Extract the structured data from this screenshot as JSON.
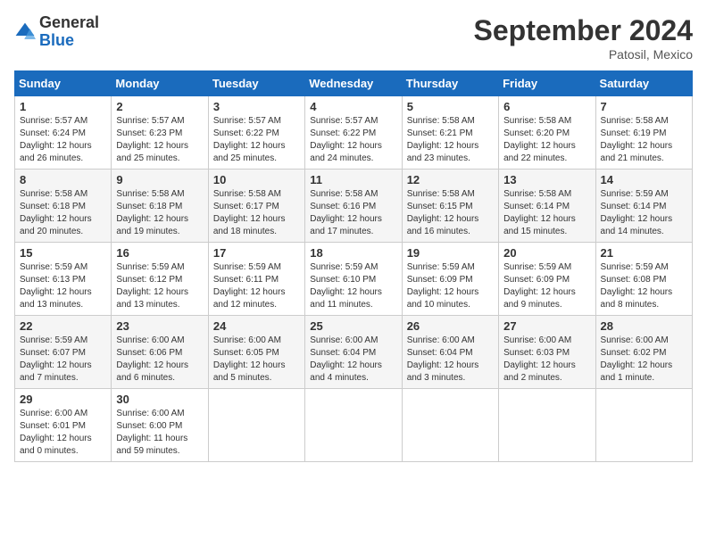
{
  "header": {
    "logo_general": "General",
    "logo_blue": "Blue",
    "title": "September 2024",
    "location": "Patosil, Mexico"
  },
  "columns": [
    "Sunday",
    "Monday",
    "Tuesday",
    "Wednesday",
    "Thursday",
    "Friday",
    "Saturday"
  ],
  "weeks": [
    [
      {
        "day": "1",
        "sunrise": "5:57 AM",
        "sunset": "6:24 PM",
        "daylight": "12 hours and 26 minutes."
      },
      {
        "day": "2",
        "sunrise": "5:57 AM",
        "sunset": "6:23 PM",
        "daylight": "12 hours and 25 minutes."
      },
      {
        "day": "3",
        "sunrise": "5:57 AM",
        "sunset": "6:22 PM",
        "daylight": "12 hours and 25 minutes."
      },
      {
        "day": "4",
        "sunrise": "5:57 AM",
        "sunset": "6:22 PM",
        "daylight": "12 hours and 24 minutes."
      },
      {
        "day": "5",
        "sunrise": "5:58 AM",
        "sunset": "6:21 PM",
        "daylight": "12 hours and 23 minutes."
      },
      {
        "day": "6",
        "sunrise": "5:58 AM",
        "sunset": "6:20 PM",
        "daylight": "12 hours and 22 minutes."
      },
      {
        "day": "7",
        "sunrise": "5:58 AM",
        "sunset": "6:19 PM",
        "daylight": "12 hours and 21 minutes."
      }
    ],
    [
      {
        "day": "8",
        "sunrise": "5:58 AM",
        "sunset": "6:18 PM",
        "daylight": "12 hours and 20 minutes."
      },
      {
        "day": "9",
        "sunrise": "5:58 AM",
        "sunset": "6:18 PM",
        "daylight": "12 hours and 19 minutes."
      },
      {
        "day": "10",
        "sunrise": "5:58 AM",
        "sunset": "6:17 PM",
        "daylight": "12 hours and 18 minutes."
      },
      {
        "day": "11",
        "sunrise": "5:58 AM",
        "sunset": "6:16 PM",
        "daylight": "12 hours and 17 minutes."
      },
      {
        "day": "12",
        "sunrise": "5:58 AM",
        "sunset": "6:15 PM",
        "daylight": "12 hours and 16 minutes."
      },
      {
        "day": "13",
        "sunrise": "5:58 AM",
        "sunset": "6:14 PM",
        "daylight": "12 hours and 15 minutes."
      },
      {
        "day": "14",
        "sunrise": "5:59 AM",
        "sunset": "6:14 PM",
        "daylight": "12 hours and 14 minutes."
      }
    ],
    [
      {
        "day": "15",
        "sunrise": "5:59 AM",
        "sunset": "6:13 PM",
        "daylight": "12 hours and 13 minutes."
      },
      {
        "day": "16",
        "sunrise": "5:59 AM",
        "sunset": "6:12 PM",
        "daylight": "12 hours and 13 minutes."
      },
      {
        "day": "17",
        "sunrise": "5:59 AM",
        "sunset": "6:11 PM",
        "daylight": "12 hours and 12 minutes."
      },
      {
        "day": "18",
        "sunrise": "5:59 AM",
        "sunset": "6:10 PM",
        "daylight": "12 hours and 11 minutes."
      },
      {
        "day": "19",
        "sunrise": "5:59 AM",
        "sunset": "6:09 PM",
        "daylight": "12 hours and 10 minutes."
      },
      {
        "day": "20",
        "sunrise": "5:59 AM",
        "sunset": "6:09 PM",
        "daylight": "12 hours and 9 minutes."
      },
      {
        "day": "21",
        "sunrise": "5:59 AM",
        "sunset": "6:08 PM",
        "daylight": "12 hours and 8 minutes."
      }
    ],
    [
      {
        "day": "22",
        "sunrise": "5:59 AM",
        "sunset": "6:07 PM",
        "daylight": "12 hours and 7 minutes."
      },
      {
        "day": "23",
        "sunrise": "6:00 AM",
        "sunset": "6:06 PM",
        "daylight": "12 hours and 6 minutes."
      },
      {
        "day": "24",
        "sunrise": "6:00 AM",
        "sunset": "6:05 PM",
        "daylight": "12 hours and 5 minutes."
      },
      {
        "day": "25",
        "sunrise": "6:00 AM",
        "sunset": "6:04 PM",
        "daylight": "12 hours and 4 minutes."
      },
      {
        "day": "26",
        "sunrise": "6:00 AM",
        "sunset": "6:04 PM",
        "daylight": "12 hours and 3 minutes."
      },
      {
        "day": "27",
        "sunrise": "6:00 AM",
        "sunset": "6:03 PM",
        "daylight": "12 hours and 2 minutes."
      },
      {
        "day": "28",
        "sunrise": "6:00 AM",
        "sunset": "6:02 PM",
        "daylight": "12 hours and 1 minute."
      }
    ],
    [
      {
        "day": "29",
        "sunrise": "6:00 AM",
        "sunset": "6:01 PM",
        "daylight": "12 hours and 0 minutes."
      },
      {
        "day": "30",
        "sunrise": "6:00 AM",
        "sunset": "6:00 PM",
        "daylight": "11 hours and 59 minutes."
      },
      null,
      null,
      null,
      null,
      null
    ]
  ]
}
